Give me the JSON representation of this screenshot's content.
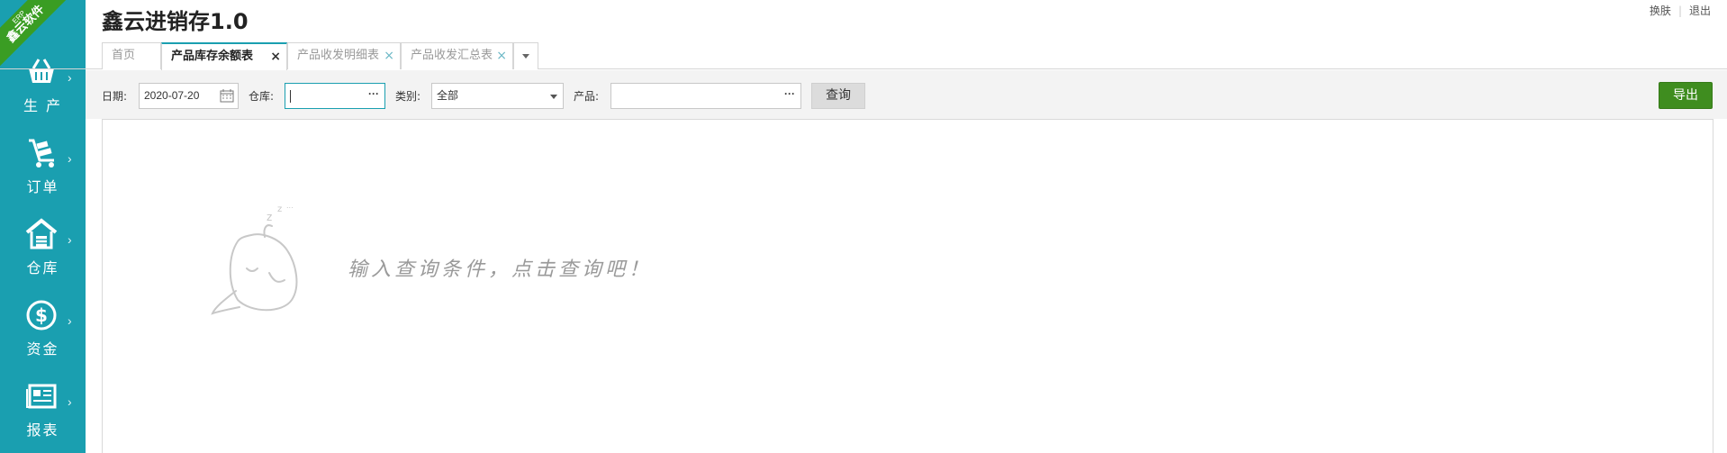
{
  "brand": {
    "ribbon_top": "ERP",
    "ribbon_main": "鑫云软件",
    "ribbon_color": "#3a9d23"
  },
  "app": {
    "title": "鑫云进销存1.0"
  },
  "top_links": {
    "switch_skin": "换肤",
    "logout": "退出"
  },
  "sidebar": {
    "color": "#1a9fb0",
    "items": [
      {
        "label": "生 产",
        "icon": "basket-icon"
      },
      {
        "label": "订单",
        "icon": "cart-icon"
      },
      {
        "label": "仓库",
        "icon": "warehouse-icon"
      },
      {
        "label": "资金",
        "icon": "dollar-icon"
      },
      {
        "label": "报表",
        "icon": "report-icon"
      }
    ],
    "chevron": "›"
  },
  "tabs": [
    {
      "label": "首页",
      "closable": false,
      "active": false
    },
    {
      "label": "产品库存余额表",
      "closable": true,
      "active": true
    },
    {
      "label": "产品收发明细表",
      "closable": true,
      "active": false
    },
    {
      "label": "产品收发汇总表",
      "closable": true,
      "active": false
    }
  ],
  "tab_close_glyph": "×",
  "filters": {
    "date_label": "日期:",
    "date_value": "2020-07-20",
    "warehouse_label": "仓库:",
    "warehouse_value": "",
    "category_label": "类别:",
    "category_value": "全部",
    "product_label": "产品:",
    "product_value": "",
    "ellipsis": "···",
    "query_button": "查询",
    "export_button": "导出",
    "export_color": "#3f8d1f"
  },
  "empty_state": {
    "message": "输入查询条件，点击查询吧！"
  }
}
